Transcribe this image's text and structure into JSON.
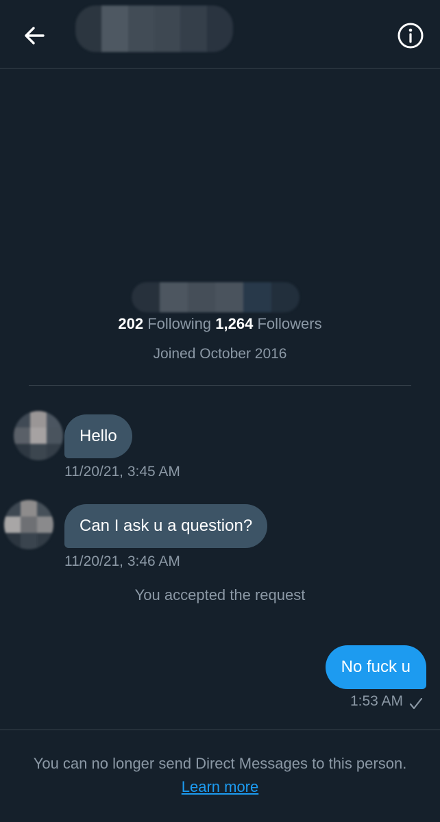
{
  "header": {
    "back_icon": "arrow-left-icon",
    "info_icon": "info-icon"
  },
  "profile": {
    "following_count": "202",
    "following_label": "Following",
    "followers_count": "1,264",
    "followers_label": "Followers",
    "joined": "Joined October 2016"
  },
  "messages": [
    {
      "text": "Hello",
      "time": "11/20/21, 3:45 AM"
    },
    {
      "text": "Can I ask u a question?",
      "time": "11/20/21, 3:46 AM"
    }
  ],
  "notice": "You accepted the request",
  "outgoing": {
    "text": "No fuck u",
    "time": "1:53 AM",
    "status_icon": "check-icon"
  },
  "footer": {
    "text": "You can no longer send Direct Messages to this person.",
    "link": "Learn more"
  },
  "colors": {
    "background": "#15202b",
    "accent": "#1d9bf0",
    "incoming_bubble": "#3d5466",
    "muted_text": "#8b98a5"
  }
}
